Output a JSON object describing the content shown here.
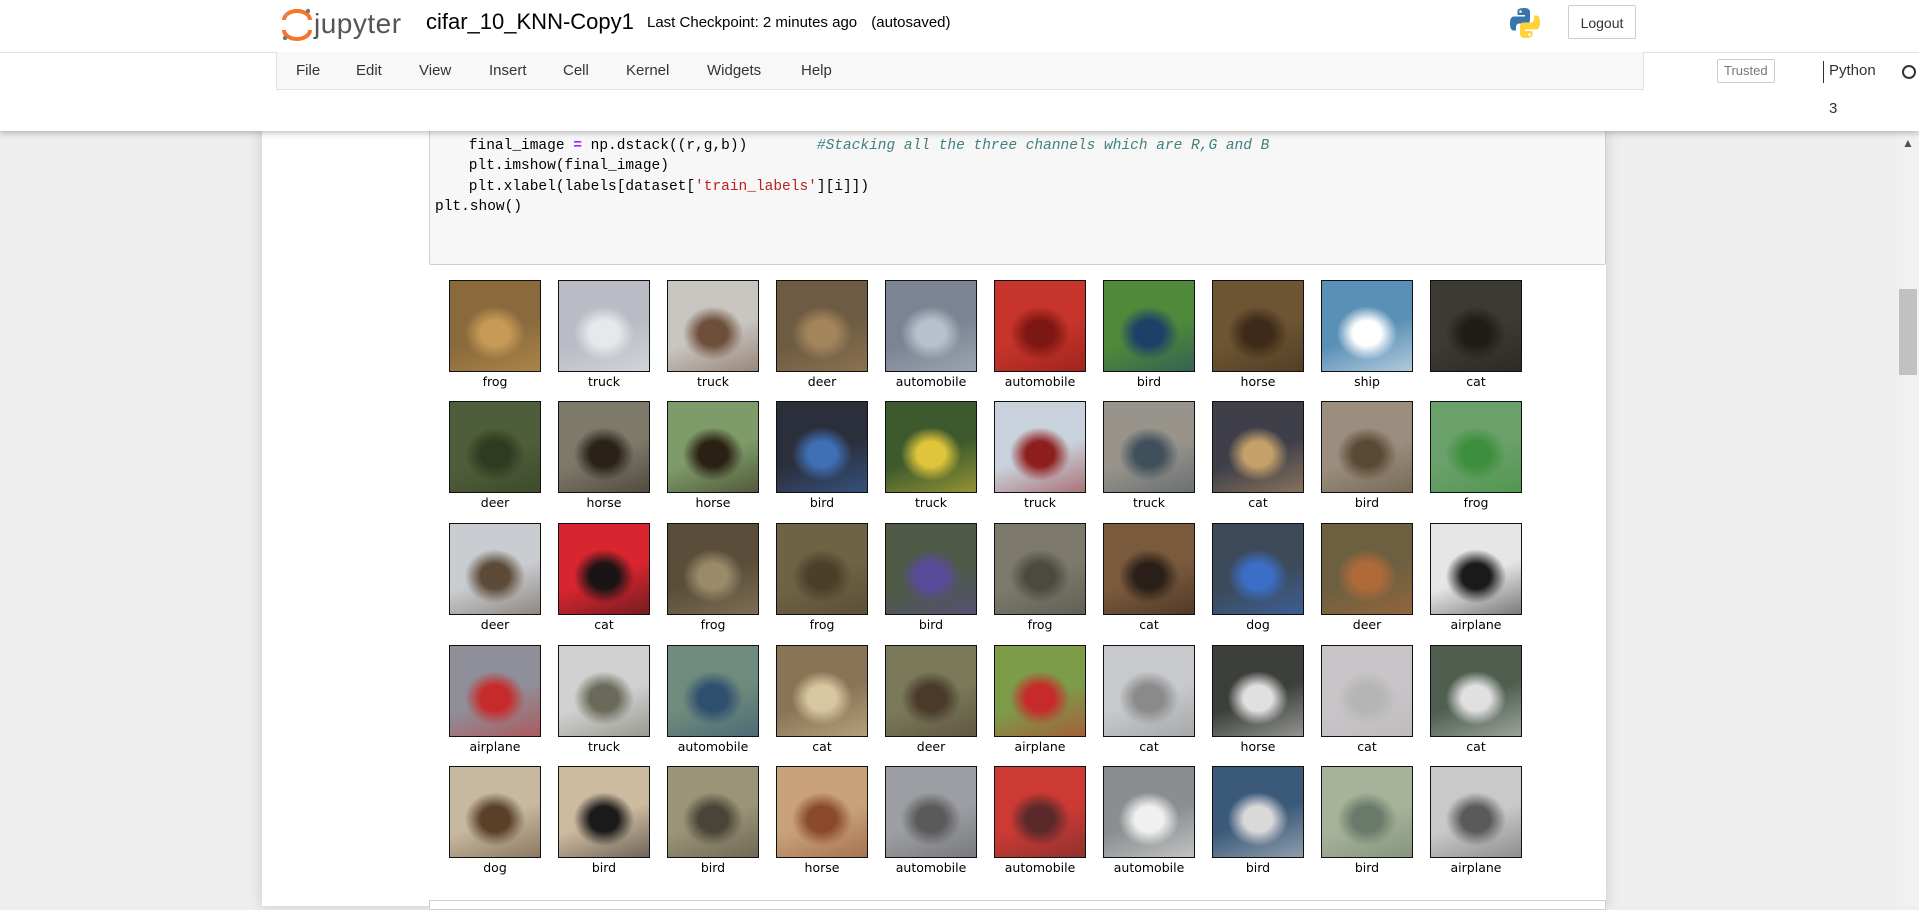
{
  "header": {
    "logo_text": "jupyter",
    "notebook_name": "cifar_10_KNN-Copy1",
    "checkpoint": "Last Checkpoint: 2 minutes ago",
    "autosave": "(autosaved)",
    "logout_label": "Logout"
  },
  "menu": {
    "items": [
      "File",
      "Edit",
      "View",
      "Insert",
      "Cell",
      "Kernel",
      "Widgets",
      "Help"
    ],
    "trusted_label": "Trusted",
    "kernel_name": "Python 3"
  },
  "code": {
    "line1_pre": "    final_image = ",
    "line1_op": "=",
    "line1_lhs": "    final_image ",
    "line1_rhs": " np.dstack((r,g,b))        ",
    "line1_comment": "#Stacking all the three channels which are R,G and B",
    "line2": "    plt.imshow(final_image)",
    "line3_pre": "    plt.xlabel(labels[dataset[",
    "line3_str": "'train_labels'",
    "line3_post": "][i]])",
    "line4": "plt.show()"
  },
  "output": {
    "labels": [
      [
        "frog",
        "truck",
        "truck",
        "deer",
        "automobile",
        "automobile",
        "bird",
        "horse",
        "ship",
        "cat"
      ],
      [
        "deer",
        "horse",
        "horse",
        "bird",
        "truck",
        "truck",
        "truck",
        "cat",
        "bird",
        "frog"
      ],
      [
        "deer",
        "cat",
        "frog",
        "frog",
        "bird",
        "frog",
        "cat",
        "dog",
        "deer",
        "airplane"
      ],
      [
        "airplane",
        "truck",
        "automobile",
        "cat",
        "deer",
        "airplane",
        "cat",
        "horse",
        "cat",
        "cat"
      ],
      [
        "dog",
        "bird",
        "bird",
        "horse",
        "automobile",
        "automobile",
        "automobile",
        "bird",
        "bird",
        "airplane"
      ]
    ],
    "thumb_colors": [
      [
        "#8a6a3c",
        "#b9bcc4",
        "#c9c6c2",
        "#6e5b43",
        "#7b8492",
        "#c7342b",
        "#4f8a3a",
        "#6d5533",
        "#5a8fb6",
        "#3c3a33"
      ],
      [
        "#4f5e3a",
        "#7e7a6a",
        "#7e9c69",
        "#2b2f3c",
        "#3d5a2e",
        "#c9d2dc",
        "#98948c",
        "#3f3f4a",
        "#9b8e7e",
        "#6aa06a"
      ],
      [
        "#c9ccd0",
        "#d9252f",
        "#5a4e3a",
        "#6f6345",
        "#4e5a45",
        "#7d7a6c",
        "#7a5a3c",
        "#3c4a5a",
        "#6d6040",
        "#e6e6e6"
      ],
      [
        "#8f8f99",
        "#d1d1d1",
        "#6f8b7d",
        "#8a7456",
        "#7a7a5a",
        "#7c9c4a",
        "#c7c9cc",
        "#3c3f3a",
        "#c9c4c8",
        "#4f5e4f"
      ],
      [
        "#c7b8a0",
        "#cdbba0",
        "#9a9478",
        "#c9a27a",
        "#9c9ea3",
        "#cc3a34",
        "#8a8e90",
        "#3b5a7a",
        "#a7b399",
        "#c9c9c9"
      ]
    ],
    "thumb_accents": [
      [
        "#c79a55",
        "#e6e8ec",
        "#6e4f3b",
        "#a3855c",
        "#b7c0cc",
        "#7d1713",
        "#1e3f68",
        "#3e2a18",
        "#ffffff",
        "#1e1d18"
      ],
      [
        "#2f3a20",
        "#2a2218",
        "#2b2014",
        "#3f6fb5",
        "#e0c43a",
        "#8f1f1f",
        "#40505a",
        "#c4a06a",
        "#5a4a35",
        "#3d8f3d"
      ],
      [
        "#5d4a38",
        "#1a1414",
        "#9b8a6a",
        "#4a402a",
        "#5a4a9a",
        "#4a4a40",
        "#2a1f18",
        "#3b6fc7",
        "#b06a3a",
        "#1a1a1a"
      ],
      [
        "#c72a2a",
        "#6a6a5a",
        "#2f4f6f",
        "#d7c6a0",
        "#4a3a2a",
        "#c72a2a",
        "#8a8a8a",
        "#e0e0e0",
        "#b5b5b5",
        "#e0e0e0"
      ],
      [
        "#5a4028",
        "#1a1a1a",
        "#4a4438",
        "#8a4a2a",
        "#5a5a5a",
        "#5a2a2a",
        "#f0f0f0",
        "#d9d9d9",
        "#6a7a6a",
        "#5a5a5a"
      ]
    ]
  }
}
